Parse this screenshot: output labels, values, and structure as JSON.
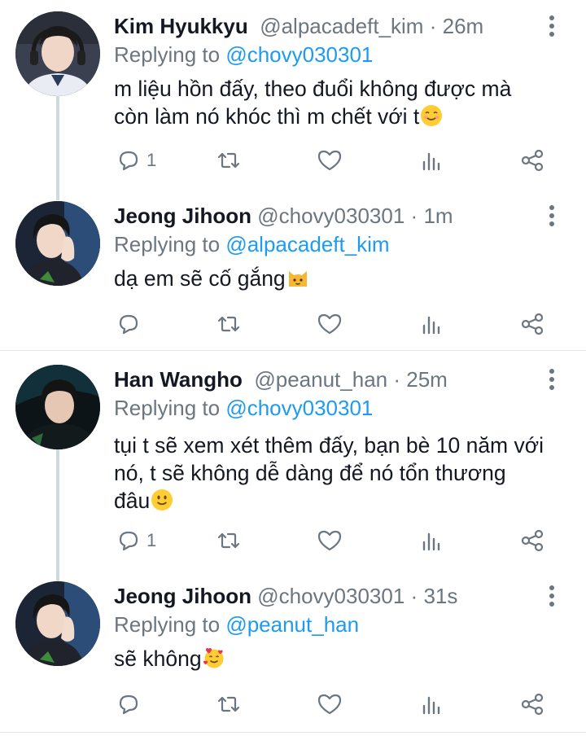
{
  "tweets": [
    {
      "name": "Kim Hyukkyu",
      "handle": "@alpacadeft_kim",
      "dot": "·",
      "time": "26m",
      "replying_label": "Replying to",
      "replying_to": "@chovy030301",
      "body_lines": [
        "m liệu hồn đấy, theo đuổi không được mà",
        "còn làm nó khóc thì m chết với t"
      ],
      "emoji": "smiling-face-icon",
      "reply_count": "1",
      "retweet_count": "",
      "like_count": ""
    },
    {
      "name": "Jeong Jihoon",
      "handle": "@chovy030301",
      "dot": "·",
      "time": "1m",
      "replying_label": "Replying to",
      "replying_to": "@alpacadeft_kim",
      "body_lines": [
        "dạ em sẽ cố gắng"
      ],
      "emoji": "cat-face-icon",
      "reply_count": "",
      "retweet_count": "",
      "like_count": ""
    },
    {
      "name": "Han Wangho",
      "handle": "@peanut_han",
      "dot": "·",
      "time": "25m",
      "replying_label": "Replying to",
      "replying_to": "@chovy030301",
      "body_lines": [
        "tụi t sẽ xem xét thêm đấy, bạn bè 10 năm với",
        "nó, t sẽ không dễ dàng để nó tổn thương",
        "đâu"
      ],
      "emoji": "slightly-smiling-face-icon",
      "reply_count": "1",
      "retweet_count": "",
      "like_count": ""
    },
    {
      "name": "Jeong Jihoon",
      "handle": "@chovy030301",
      "dot": "·",
      "time": "31s",
      "replying_label": "Replying to",
      "replying_to": "@peanut_han",
      "body_lines": [
        "sẽ không"
      ],
      "emoji": "smiling-face-with-hearts-icon",
      "reply_count": "",
      "retweet_count": "",
      "like_count": ""
    }
  ],
  "colors": {
    "text": "#141823",
    "secondary": "#6b7680",
    "link": "#1d9bf0",
    "thread_line": "#cfd9de",
    "separator": "#e1e6ea"
  }
}
